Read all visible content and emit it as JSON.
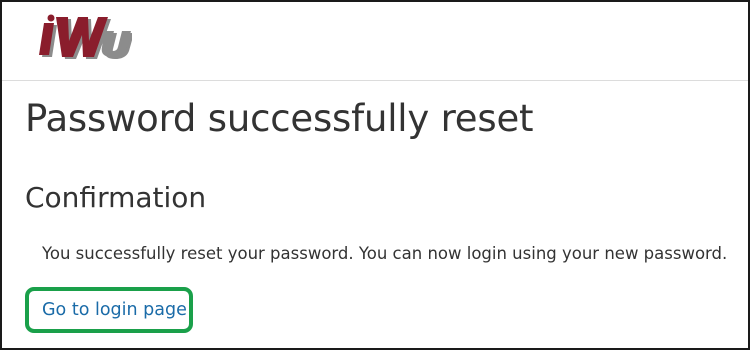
{
  "header": {
    "logo_text": "IWU",
    "colors": {
      "logo_red": "#8a1d2c",
      "logo_gray": "#8c8c8c"
    }
  },
  "main": {
    "page_title": "Password successfully reset",
    "section_title": "Confirmation",
    "message": "You successfully reset your password. You can now login using your new password.",
    "login_link_label": "Go to login page"
  },
  "colors": {
    "link": "#1a6ba8",
    "highlight": "#1aa04a",
    "text": "#333333"
  }
}
